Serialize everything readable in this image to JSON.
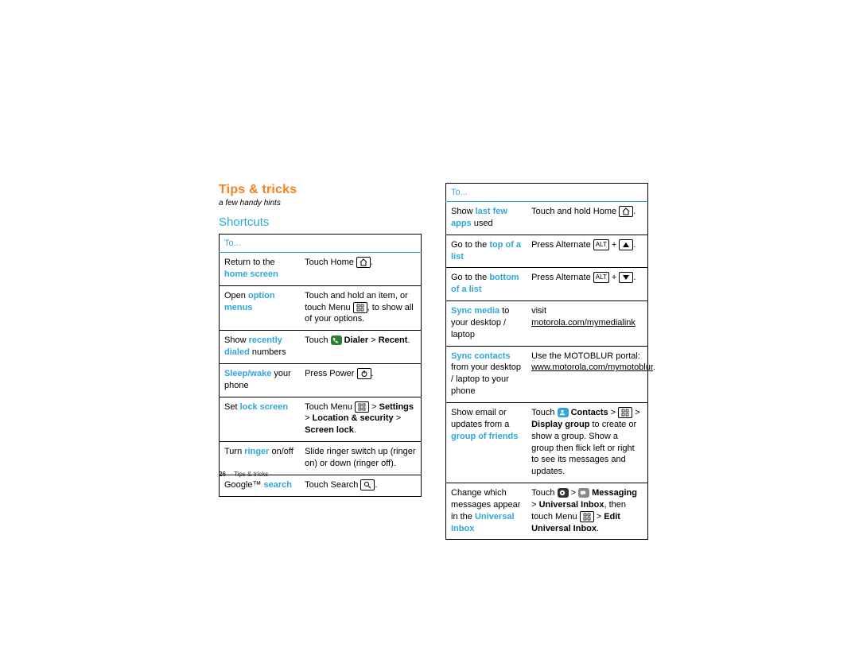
{
  "header": {
    "title": "Tips & tricks",
    "subtitle": "a few handy hints",
    "section": "Shortcuts"
  },
  "table_header": "To...",
  "left": [
    {
      "to_pre": "Return to the ",
      "to_hl": "home screen",
      "to_post": "",
      "act": {
        "type": "home"
      }
    },
    {
      "to_pre": "Open ",
      "to_hl": "option menus",
      "to_post": "",
      "act": {
        "type": "menus"
      }
    },
    {
      "to_pre": "Show ",
      "to_hl": "recently dialed",
      "to_post": " numbers",
      "act": {
        "type": "dialer"
      }
    },
    {
      "to_hl_first": "Sleep/wake",
      "to_post": " your phone",
      "act": {
        "type": "power"
      }
    },
    {
      "to_pre": "Set ",
      "to_hl": "lock screen",
      "to_post": "",
      "act": {
        "type": "lockscreen"
      }
    },
    {
      "to_pre": "Turn ",
      "to_hl": "ringer",
      "to_post": " on/off",
      "act": {
        "type": "ringer"
      }
    },
    {
      "to_pre": "Google™ ",
      "to_hl": "search",
      "to_post": "",
      "act": {
        "type": "search"
      }
    }
  ],
  "right": [
    {
      "to_pre": "Show ",
      "to_hl": "last few apps",
      "to_post": " used",
      "act": {
        "type": "holdhome"
      }
    },
    {
      "to_pre": "Go to the ",
      "to_hl": "top of a list",
      "to_post": "",
      "act": {
        "type": "altup"
      }
    },
    {
      "to_pre": "Go to the ",
      "to_hl": "bottom of a list",
      "to_post": "",
      "act": {
        "type": "altdown"
      }
    },
    {
      "to_hl_first": "Sync media",
      "to_post": " to your desktop / laptop",
      "act": {
        "type": "syncmedia",
        "link": "motorola.com/mymedialink"
      }
    },
    {
      "to_hl_first": "Sync contacts",
      "to_post": " from your desktop / laptop to your phone",
      "act": {
        "type": "synccontacts",
        "link": "www.motorola.com/mymotoblur"
      }
    },
    {
      "to_pre": "Show email or updates from a ",
      "to_hl": "group of friends",
      "to_post": "",
      "act": {
        "type": "contacts"
      }
    },
    {
      "to_pre": "Change which messages appear in the ",
      "to_hl": "Universal Inbox",
      "to_post": "",
      "act": {
        "type": "inbox"
      }
    }
  ],
  "action_strings": {
    "home": "Touch Home ",
    "menus_a": "Touch and hold an item, or touch Menu ",
    "menus_b": ", to show all of your options.",
    "dialer_a": "Touch ",
    "dialer_b": "Dialer",
    "dialer_c": "Recent",
    "power": "Press Power ",
    "lockscreen_a": "Touch Menu ",
    "lockscreen_b": "Settings",
    "lockscreen_c": "Location & security",
    "lockscreen_d": "Screen lock",
    "ringer": "Slide ringer switch up (ringer on) or down (ringer off).",
    "search": "Touch Search ",
    "holdhome": "Touch and hold Home ",
    "alt_a": "Press Alternate ",
    "alt_key": "ALT",
    "syncmedia_a": "visit ",
    "synccontacts_a": "Use the MOTOBLUR portal: ",
    "contacts_a": "Touch ",
    "contacts_b": "Contacts",
    "contacts_c": "Display group",
    "contacts_d": " to create or show a group. Show a group then flick left or right to see its messages and updates.",
    "inbox_a": "Touch ",
    "inbox_b": "Messaging",
    "inbox_c": "Universal Inbox",
    "inbox_d": ", then touch Menu ",
    "inbox_e": "Edit Universal Inbox",
    "gt": " > "
  },
  "footer": {
    "page": "26",
    "label": "Tips & tricks"
  }
}
